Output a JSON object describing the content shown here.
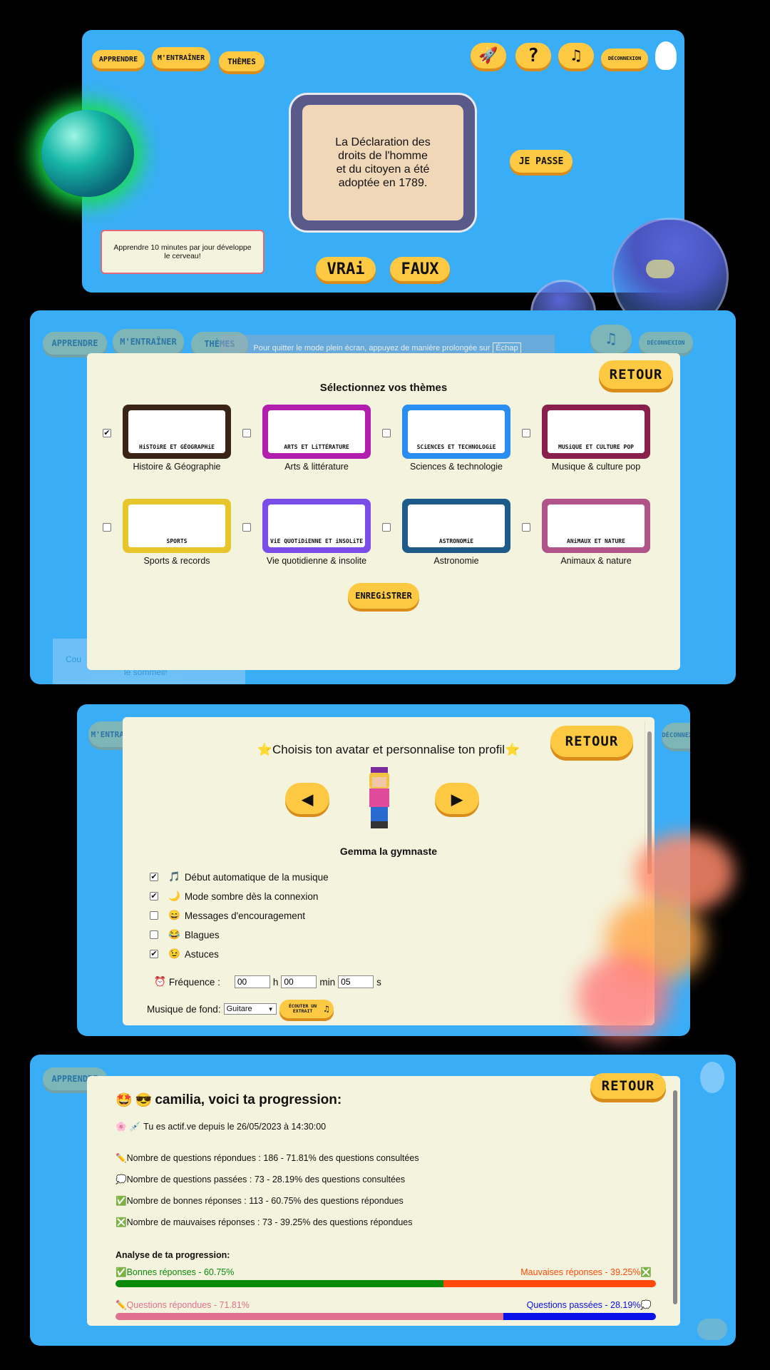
{
  "nav": {
    "apprendre": "APPRENDRE",
    "entrainer": "M'ENTRAÎNER",
    "themes": "THÈMES",
    "deconnexion": "DÉCONNEXION"
  },
  "quiz": {
    "question": "La Déclaration des droits de l'homme et du citoyen a été adoptée en 1789.",
    "skip": "JE PASSE",
    "true": "VRAi",
    "false": "FAUX",
    "tip": "Apprendre 10 minutes par jour développe le cerveau!"
  },
  "themes_screen": {
    "fullscreen_notice": "Pour quitter le mode plein écran, appuyez de manière prolongée sur",
    "fullscreen_key": "Échap",
    "retour": "RETOUR",
    "title": "Sélectionnez vos thèmes",
    "save": "ENREGiSTRER",
    "bg_tip_a": "Cou",
    "bg_tip_b": "le sommeil!",
    "themes": [
      {
        "label": "Histoire & Géographie",
        "card_text": "HiSTOiRE ET GÉOGRAPHiE",
        "checked": true,
        "color": "#3a2418"
      },
      {
        "label": "Arts & littérature",
        "card_text": "ARTS ET LiTTÉRATURE",
        "checked": false,
        "color": "#b21fae"
      },
      {
        "label": "Sciences & technologie",
        "card_text": "SCiENCES ET TECHNOLOGiE",
        "checked": false,
        "color": "#2a8df0"
      },
      {
        "label": "Musique & culture pop",
        "card_text": "MUSiQUE ET CULTURE POP",
        "checked": false,
        "color": "#8a1f4e"
      },
      {
        "label": "Sports & records",
        "card_text": "SPORTS",
        "checked": false,
        "color": "#e6c62a"
      },
      {
        "label": "Vie quotidienne & insolite",
        "card_text": "ViE QUOTiDiENNE ET iNSOLiTE",
        "checked": false,
        "color": "#7a4de8"
      },
      {
        "label": "Astronomie",
        "card_text": "ASTRONOMiE",
        "checked": false,
        "color": "#1e5a8a"
      },
      {
        "label": "Animaux & nature",
        "card_text": "ANiMAUX ET NATURE",
        "checked": false,
        "color": "#b0548a"
      }
    ]
  },
  "profile": {
    "retour": "RETOUR",
    "title": "Choisis ton avatar et personnalise ton profil",
    "avatar_name": "Gemma la gymnaste",
    "options": [
      {
        "icon": "🎵",
        "label": "Début automatique de la musique",
        "checked": true
      },
      {
        "icon": "🌙",
        "label": "Mode sombre dès la connexion",
        "checked": true
      },
      {
        "icon": "😄",
        "label": "Messages d'encouragement",
        "checked": false
      },
      {
        "icon": "😂",
        "label": "Blagues",
        "checked": false
      },
      {
        "icon": "😉",
        "label": "Astuces",
        "checked": true
      }
    ],
    "frequency_label": "Fréquence :",
    "freq_h": "00",
    "freq_h_unit": "h",
    "freq_min": "00",
    "freq_min_unit": "min",
    "freq_s": "05",
    "freq_s_unit": "s",
    "music_label": "Musique de fond:",
    "music_value": "Guitare",
    "listen_button": "ÉCOUTER UN EXTRAIT"
  },
  "progress": {
    "retour": "RETOUR",
    "title": "camilia, voici ta progression:",
    "active_since": "Tu es actif.ve depuis le 26/05/2023 à 14:30:00",
    "stats": [
      {
        "icon": "✏️",
        "text": "Nombre de questions répondues : 186 - 71.81% des questions consultées"
      },
      {
        "icon": "💭",
        "text": "Nombre de questions passées : 73 - 28.19% des questions consultées"
      },
      {
        "icon": "✅",
        "text": "Nombre de bonnes réponses : 113 - 60.75% des questions répondues"
      },
      {
        "icon": "❎",
        "text": "Nombre de mauvaises réponses : 73 - 39.25% des questions répondues"
      }
    ],
    "analysis_title": "Analyse de ta progression:",
    "good_label": "Bonnes réponses - 60.75%",
    "bad_label": "Mauvaises réponses - 39.25%",
    "good_fraction": 0.6075,
    "answered_label": "Questions répondues - 71.81%",
    "skipped_label": "Questions passées - 28.19%",
    "answered_fraction": 0.7181,
    "colors": {
      "good": "#0a8a0a",
      "bad": "#ff4a0a",
      "answered": "#e07090",
      "skipped": "#0a10e8"
    }
  }
}
